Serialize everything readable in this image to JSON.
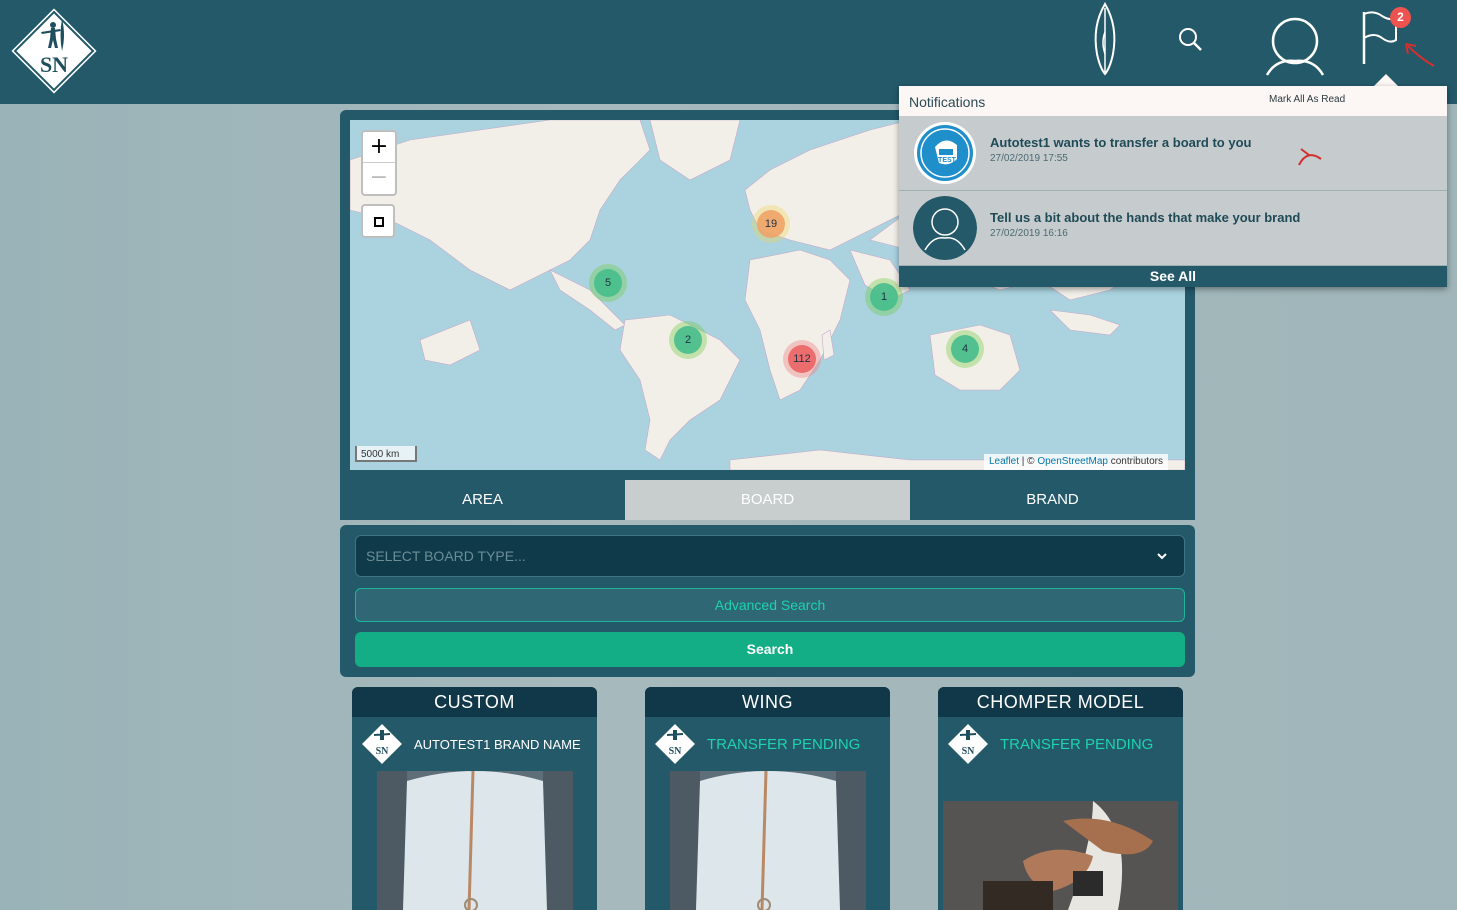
{
  "header": {
    "logo_text": "SN",
    "icons": [
      "surfboard-icon",
      "search-icon",
      "user-icon",
      "flag-icon"
    ],
    "notification_count": "2"
  },
  "map": {
    "zoom_in": "+",
    "zoom_out": "−",
    "scale": "5000 km",
    "attribution": {
      "leaflet": "Leaflet",
      "sep": " | © ",
      "osm": "OpenStreetMap",
      "suffix": " contributors"
    },
    "clusters": [
      "19",
      "5",
      "1",
      "2",
      "112",
      "4"
    ]
  },
  "tabs": [
    "AREA",
    "BOARD",
    "BRAND"
  ],
  "active_tab": "BOARD",
  "search": {
    "select_placeholder": "SELECT BOARD TYPE...",
    "advanced_label": "Advanced Search",
    "search_label": "Search"
  },
  "cards": [
    {
      "title": "CUSTOM",
      "brand": "AUTOTEST1 BRAND NAME"
    },
    {
      "title": "WING",
      "brand": "TRANSFER PENDING"
    },
    {
      "title": "CHOMPER MODEL",
      "brand": "TRANSFER PENDING"
    }
  ],
  "notifications": {
    "title": "Notifications",
    "mark_all": "Mark All As Read",
    "items": [
      {
        "text": "Autotest1 wants to transfer a board to you",
        "date": "27/02/2019 17:55",
        "avatar_text": "TEST"
      },
      {
        "text": "Tell us a bit about the hands that make your brand",
        "date": "27/02/2019 16:16"
      }
    ],
    "see_all": "See All"
  },
  "colors": {
    "header": "#245969",
    "accent_green": "#13ad86",
    "badge": "#ef5350"
  }
}
